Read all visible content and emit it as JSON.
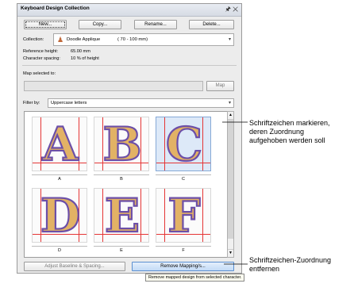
{
  "panel": {
    "title": "Keyboard Design Collection",
    "title_icons": [
      "pin-icon",
      "close-icon"
    ],
    "toolbar": {
      "new_label": "New...",
      "copy_label": "Copy...",
      "rename_label": "Rename...",
      "delete_label": "Delete..."
    },
    "collection_label": "Collection:",
    "collection_value": "Doodle Applique",
    "collection_range": "( 70 - 100 mm)",
    "reference_height_label": "Reference height:",
    "reference_height_value": "65.00 mm",
    "character_spacing_label": "Character spacing:",
    "character_spacing_value": "10 % of height",
    "map_selected_label": "Map selected to:",
    "map_input_value": "",
    "map_button_label": "Map",
    "filter_label": "Filter by:",
    "filter_value": "Uppercase letters",
    "grid": {
      "cells": [
        {
          "glyph": "A",
          "caption": "A",
          "selected": false
        },
        {
          "glyph": "B",
          "caption": "B",
          "selected": false
        },
        {
          "glyph": "C",
          "caption": "C",
          "selected": true
        },
        {
          "glyph": "D",
          "caption": "D",
          "selected": false
        },
        {
          "glyph": "E",
          "caption": "E",
          "selected": false
        },
        {
          "glyph": "F",
          "caption": "F",
          "selected": false
        }
      ]
    },
    "adjust_button_label": "Adjust Baseline & Spacing...",
    "remove_button_label": "Remove Mapping/s...",
    "tooltip": "Remove mapped design from selected character."
  },
  "callouts": {
    "mark_characters": [
      "Schriftzeichen markieren,",
      "deren Zuordnung",
      "aufgehoben werden soll"
    ],
    "remove_mapping": [
      "Schriftzeichen-Zuordnung",
      "entfernen"
    ]
  },
  "colors": {
    "glyph_fill": "#e2b265",
    "glyph_outline": "#6c4fa8",
    "guide_line": "#e53535",
    "selected_cell": "#dde9f8"
  }
}
